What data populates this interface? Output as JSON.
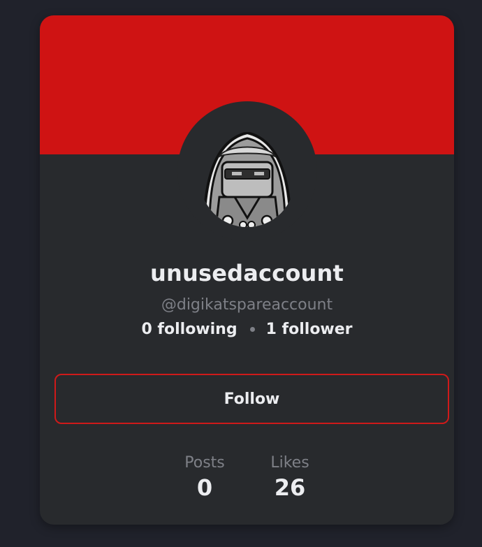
{
  "colors": {
    "page_background": "#20222b",
    "card_background": "#282a2d",
    "banner": "#cf1313",
    "accent_border": "#cf1a1a",
    "text_primary": "#ecedf0",
    "text_muted": "#7e8087"
  },
  "profile": {
    "avatar_icon": "hooded-character-avatar-icon",
    "display_name": "unusedaccount",
    "handle": "@digikatspareaccount",
    "following": "0 following",
    "followers": "1 follower"
  },
  "actions": {
    "follow_label": "Follow"
  },
  "stats": [
    {
      "label": "Posts",
      "value": "0"
    },
    {
      "label": "Likes",
      "value": "26"
    }
  ]
}
